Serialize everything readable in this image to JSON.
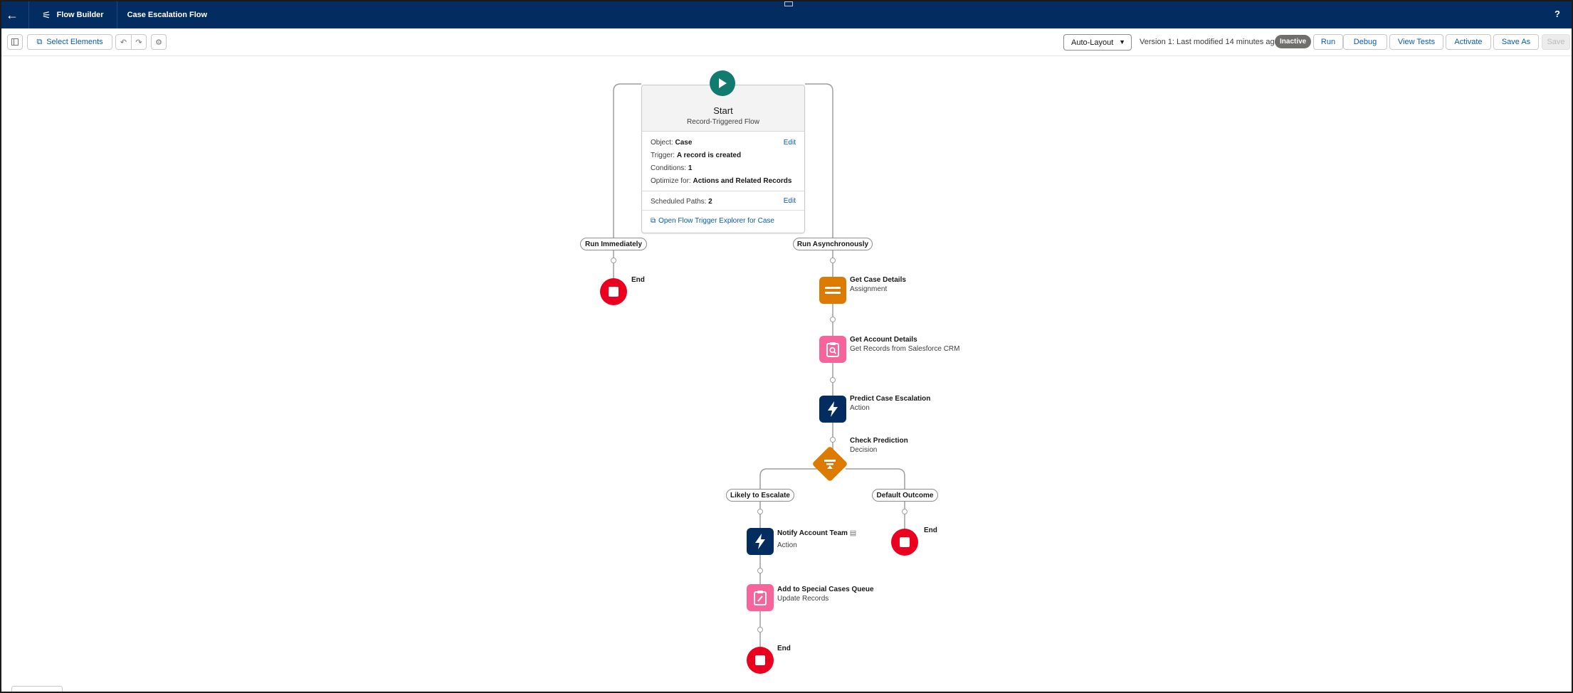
{
  "topbar": {
    "app_title": "Flow Builder",
    "flow_name": "Case Escalation Flow",
    "help": "?"
  },
  "toolbar": {
    "select_elements": "Select Elements",
    "layout_select": "Auto-Layout",
    "version_text": "Version 1: Last modified 14 minutes ago",
    "status_badge": "Inactive",
    "run": "Run",
    "debug": "Debug",
    "view_tests": "View Tests",
    "activate": "Activate",
    "save_as": "Save As",
    "save": "Save"
  },
  "start": {
    "title": "Start",
    "subtitle": "Record-Triggered Flow",
    "object_label": "Object:",
    "object_value": "Case",
    "trigger_label": "Trigger:",
    "trigger_value": "A record is created",
    "conditions_label": "Conditions:",
    "conditions_value": "1",
    "optimize_label": "Optimize for:",
    "optimize_value": "Actions and Related Records",
    "scheduled_label": "Scheduled Paths:",
    "scheduled_value": "2",
    "edit": "Edit",
    "explorer_link": "Open Flow Trigger Explorer for Case"
  },
  "paths": {
    "run_immediately": "Run Immediately",
    "run_async": "Run Asynchronously",
    "likely_escalate": "Likely to Escalate",
    "default_outcome": "Default Outcome"
  },
  "elements": {
    "get_case": {
      "name": "Get Case Details",
      "type": "Assignment"
    },
    "get_account": {
      "name": "Get Account Details",
      "type": "Get Records from Salesforce CRM"
    },
    "predict": {
      "name": "Predict Case Escalation",
      "type": "Action"
    },
    "check": {
      "name": "Check Prediction",
      "type": "Decision"
    },
    "notify": {
      "name": "Notify Account Team",
      "type": "Action"
    },
    "add_queue": {
      "name": "Add to Special Cases Queue",
      "type": "Update Records"
    }
  },
  "end_label": "End",
  "colors": {
    "header": "#032d60",
    "start": "#107b6e",
    "assignment": "#dd7a01",
    "records": "#f7649b",
    "action": "#032d60",
    "end": "#ea001e",
    "link": "#0b5cab"
  }
}
